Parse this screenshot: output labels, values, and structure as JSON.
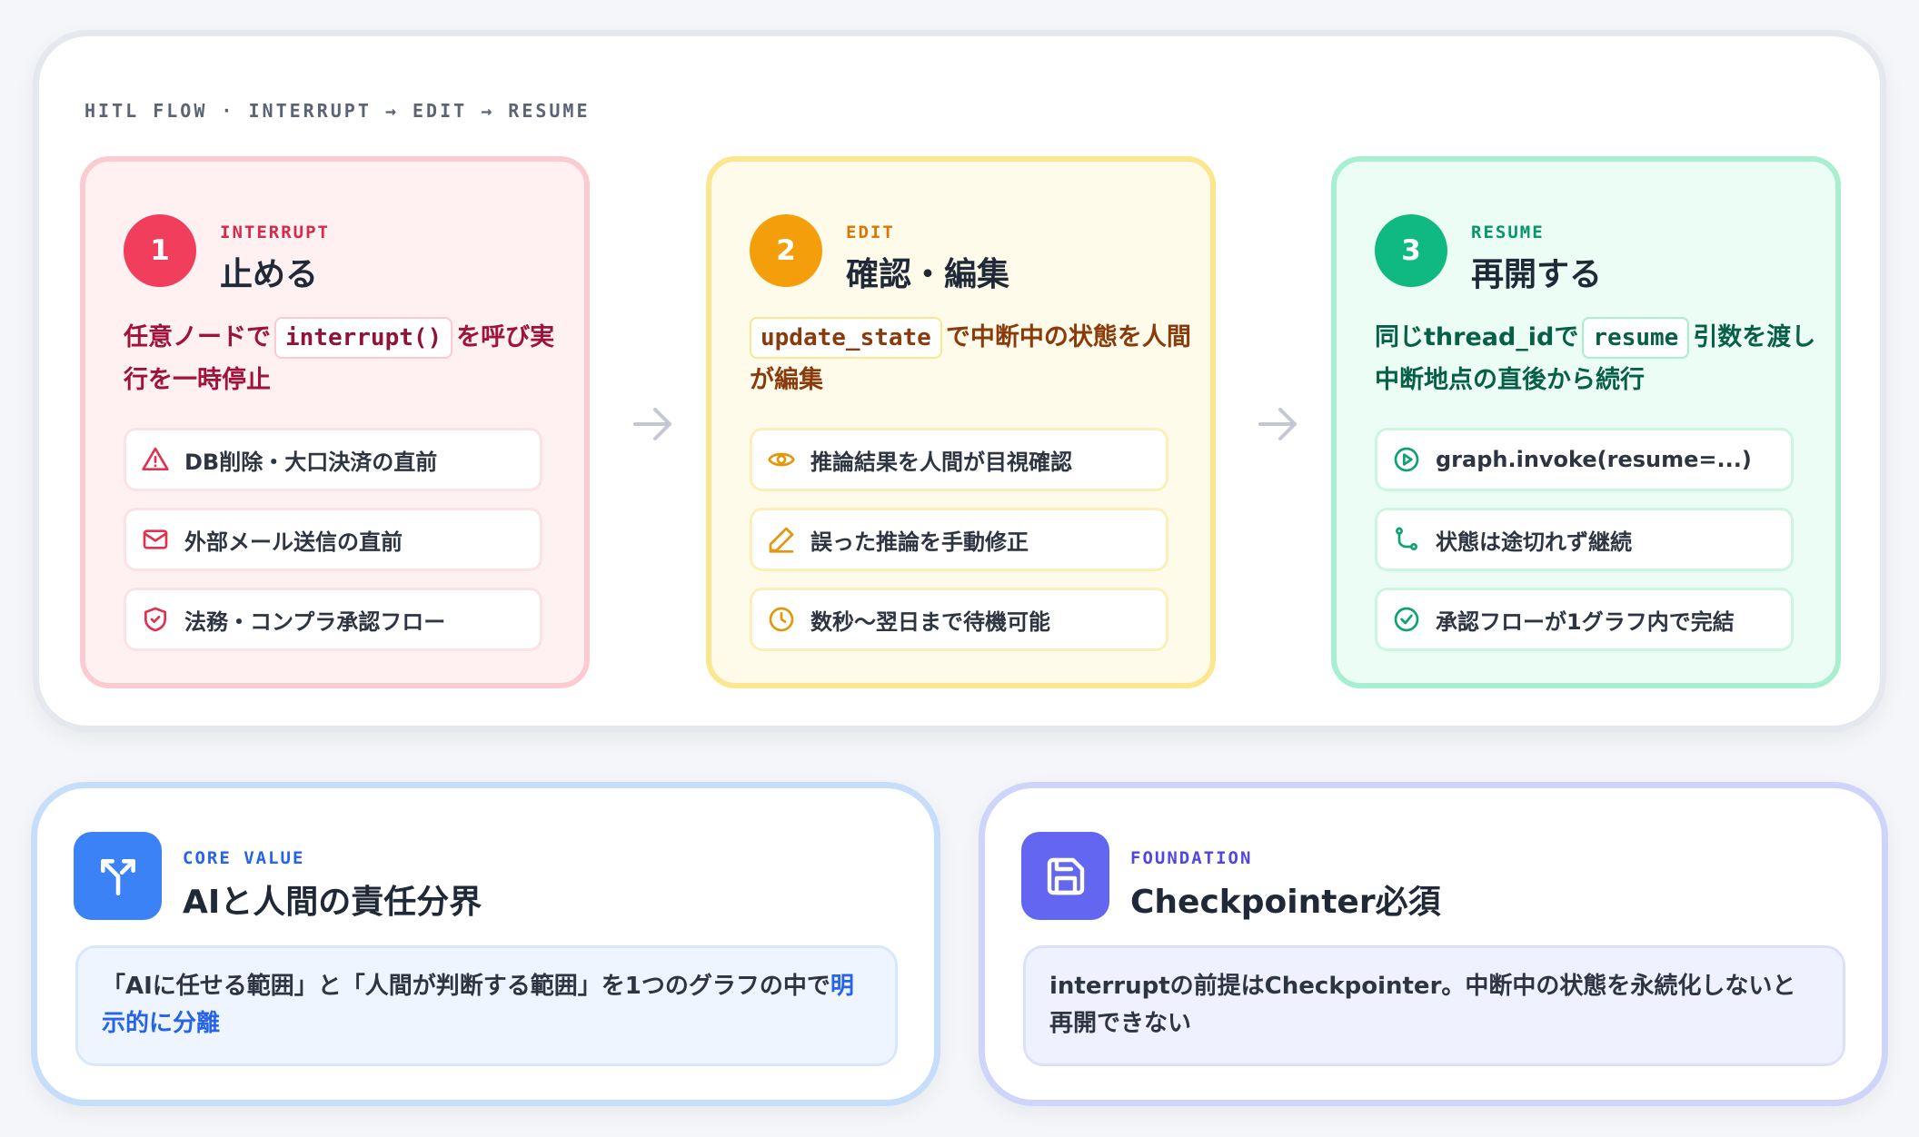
{
  "flow": {
    "label": "HITL FLOW · INTERRUPT → EDIT → RESUME",
    "steps": [
      {
        "number": "1",
        "tag": "INTERRUPT",
        "title": "止める",
        "desc_before": "任意ノードで",
        "desc_code": "interrupt()",
        "desc_after": "を呼び実行を一時停止",
        "items": [
          {
            "icon": "warning-triangle-icon",
            "text": "DB削除・大口決済の直前"
          },
          {
            "icon": "mail-icon",
            "text": "外部メール送信の直前"
          },
          {
            "icon": "shield-check-icon",
            "text": "法務・コンプラ承認フロー"
          }
        ]
      },
      {
        "number": "2",
        "tag": "EDIT",
        "title": "確認・編集",
        "desc_before": "",
        "desc_code": "update_state",
        "desc_after": "で中断中の状態を人間が編集",
        "items": [
          {
            "icon": "eye-icon",
            "text": "推論結果を人間が目視確認"
          },
          {
            "icon": "pencil-icon",
            "text": "誤った推論を手動修正"
          },
          {
            "icon": "clock-icon",
            "text": "数秒〜翌日まで待機可能"
          }
        ]
      },
      {
        "number": "3",
        "tag": "RESUME",
        "title": "再開する",
        "desc_before": "同じthread_idで",
        "desc_code": "resume",
        "desc_after": "引数を渡し中断地点の直後から続行",
        "items": [
          {
            "icon": "play-circle-icon",
            "text": "graph.invoke(resume=...)"
          },
          {
            "icon": "branch-icon",
            "text": "状態は途切れず継続"
          },
          {
            "icon": "check-circle-icon",
            "text": "承認フローが1グラフ内で完結"
          }
        ]
      }
    ]
  },
  "core_value": {
    "icon": "split-arrow-icon",
    "tag": "CORE VALUE",
    "title": "AIと人間の責任分界",
    "text_before": "「AIに任せる範囲」と「人間が判断する範囲」を1つのグラフの中で",
    "text_highlight": "明示的に分離"
  },
  "foundation": {
    "icon": "save-icon",
    "tag": "FOUNDATION",
    "title": "Checkpointer必須",
    "text": "interruptの前提はCheckpointer。中断中の状態を永続化しないと再開できない"
  },
  "colors": {
    "interrupt": "#f03e5c",
    "edit": "#f59e0b",
    "resume": "#10b981",
    "core_value": "#3b82f6",
    "foundation": "#6366f1"
  }
}
